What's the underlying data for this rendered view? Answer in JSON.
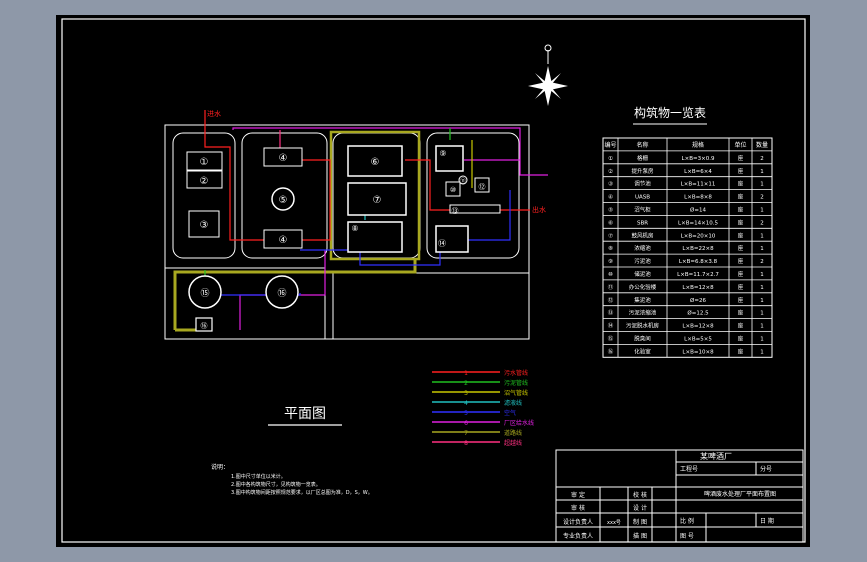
{
  "colors": {
    "background": "#000000",
    "frame": "#ffffff",
    "red": "#ff2020",
    "green": "#20c020",
    "yellow": "#c8c800",
    "cyan": "#20c0c0",
    "blue": "#3030ff",
    "magenta": "#e020e0",
    "olive": "#a8a820",
    "pink": "#ff3080"
  },
  "diagram": {
    "plan_title": "平面图",
    "table_title": "构筑物一览表",
    "inlet_label": "进水",
    "outlet_label": "出水",
    "units": [
      {
        "no": "①"
      },
      {
        "no": "②"
      },
      {
        "no": "③"
      },
      {
        "no": "④"
      },
      {
        "no": "④"
      },
      {
        "no": "⑤"
      },
      {
        "no": "⑥"
      },
      {
        "no": "⑦"
      },
      {
        "no": "⑧"
      },
      {
        "no": "⑨"
      },
      {
        "no": "⑩"
      },
      {
        "no": "⑪"
      },
      {
        "no": "⑫"
      },
      {
        "no": "⑬"
      },
      {
        "no": "⑭"
      },
      {
        "no": "⑮"
      },
      {
        "no": "⑯"
      }
    ]
  },
  "table": {
    "headers": [
      "编号",
      "名称",
      "规格",
      "单位",
      "数量"
    ],
    "rows": [
      [
        "①",
        "格栅",
        "L×B=3×0.9",
        "座",
        "2"
      ],
      [
        "②",
        "提升泵房",
        "L×B=6×4",
        "座",
        "1"
      ],
      [
        "③",
        "调节池",
        "L×B=11×11",
        "座",
        "1"
      ],
      [
        "④",
        "UASB",
        "L×B=8×8",
        "座",
        "2"
      ],
      [
        "⑤",
        "沼气柜",
        "Ø=14",
        "座",
        "1"
      ],
      [
        "⑥",
        "SBR",
        "L×B=14×10.5",
        "座",
        "2"
      ],
      [
        "⑦",
        "鼓风机房",
        "L×B=20×10",
        "座",
        "1"
      ],
      [
        "⑧",
        "浓缩池",
        "L×B=22×8",
        "座",
        "1"
      ],
      [
        "⑨",
        "污泥池",
        "L×B=6.8×3.8",
        "座",
        "2"
      ],
      [
        "⑩",
        "储泥池",
        "L×B=11.7×2.7",
        "座",
        "1"
      ],
      [
        "⑪",
        "办公化验楼",
        "L×B=12×8",
        "座",
        "1"
      ],
      [
        "⑫",
        "集泥池",
        "Ø=26",
        "座",
        "1"
      ],
      [
        "⑬",
        "污泥浓缩池",
        "Ø=12.5",
        "座",
        "1"
      ],
      [
        "⑭",
        "污泥脱水机房",
        "L×B=12×8",
        "座",
        "1"
      ],
      [
        "⑮",
        "脱臭间",
        "L×B=5×5",
        "座",
        "1"
      ],
      [
        "⑯",
        "化验室",
        "L×B=10×8",
        "座",
        "1"
      ]
    ]
  },
  "legend": [
    {
      "num": "1",
      "label": "污水管线",
      "color": "#ff2020"
    },
    {
      "num": "2",
      "label": "污泥管线",
      "color": "#20c020"
    },
    {
      "num": "3",
      "label": "沼气管线",
      "color": "#c8c800"
    },
    {
      "num": "4",
      "label": "滤液线",
      "color": "#20c0c0"
    },
    {
      "num": "5",
      "label": "空气",
      "color": "#3030ff"
    },
    {
      "num": "6",
      "label": "厂区给水线",
      "color": "#e020e0"
    },
    {
      "num": "7",
      "label": "道路线",
      "color": "#a8a820"
    },
    {
      "num": "8",
      "label": "超越线",
      "color": "#ff3080"
    }
  ],
  "notes": {
    "heading": "说明：",
    "lines": [
      "1.图中尺寸单位以米计。",
      "2.图中各构筑物尺寸，见构筑物一览表。",
      "3.图中构筑物间距按照规范要求，以厂区总图为准，D，S，W。"
    ]
  },
  "title_block": {
    "company": "某啤酒厂",
    "project_label": "工程号",
    "number_label": "分号",
    "drawing_title": "啤酒废水处理厂平面布置图",
    "rows": [
      [
        "审 定",
        "",
        "校 核",
        ""
      ],
      [
        "审 核",
        "",
        "设 计",
        ""
      ],
      [
        "设计负责人",
        "xxx号",
        "制 图",
        ""
      ],
      [
        "专业负责人",
        "",
        "描 图",
        ""
      ]
    ],
    "ratio_label": "比 例",
    "date_label": "日 期",
    "drawing_no_label": "图 号"
  }
}
